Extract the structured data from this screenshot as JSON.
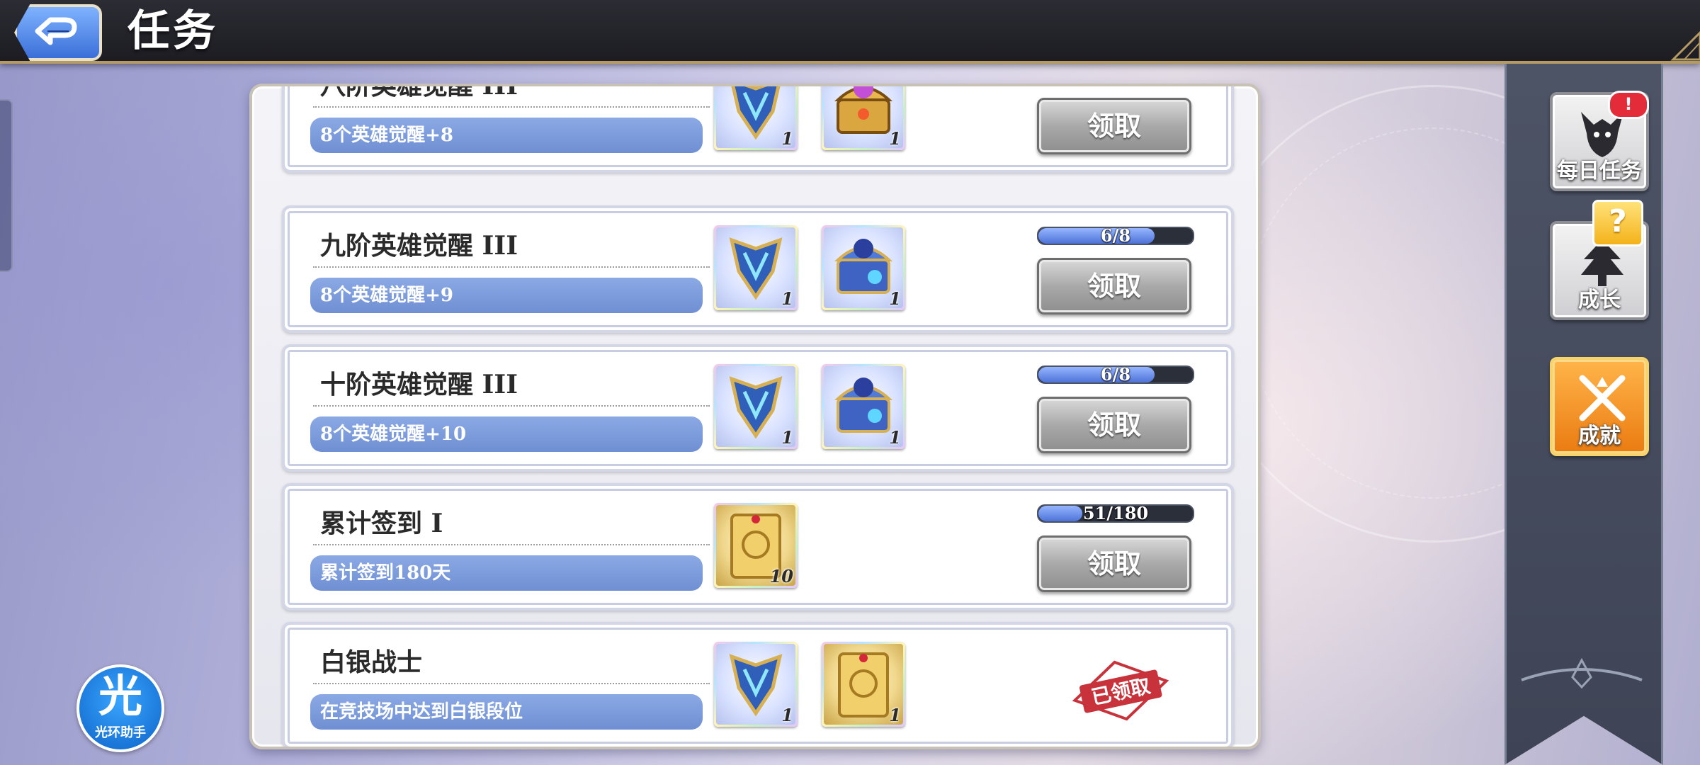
{
  "header": {
    "title": "任务",
    "back_icon": "back-arrow-icon"
  },
  "tasks": [
    {
      "name": "八阶英雄觉醒 III",
      "desc": "8个英雄觉醒+8",
      "rewards": [
        {
          "icon": "armor-piece-icon",
          "count": "1"
        },
        {
          "icon": "treasure-chest-icon",
          "count": "1"
        }
      ],
      "progress_text": "",
      "button": "领取",
      "status": "claimable"
    },
    {
      "name": "九阶英雄觉醒 III",
      "desc": "8个英雄觉醒+9",
      "rewards": [
        {
          "icon": "armor-piece-icon",
          "count": "1"
        },
        {
          "icon": "treasure-chest-icon",
          "count": "1"
        }
      ],
      "progress_text": "6/8",
      "progress_value": 0.75,
      "button": "领取",
      "status": "claimable"
    },
    {
      "name": "十阶英雄觉醒 III",
      "desc": "8个英雄觉醒+10",
      "rewards": [
        {
          "icon": "armor-piece-icon",
          "count": "1"
        },
        {
          "icon": "treasure-chest-icon",
          "count": "1"
        }
      ],
      "progress_text": "6/8",
      "progress_value": 0.75,
      "button": "领取",
      "status": "claimable"
    },
    {
      "name": "累计签到 I",
      "desc": "累计签到180天",
      "rewards": [
        {
          "icon": "gold-card-icon",
          "count": "10"
        }
      ],
      "progress_text": "51/180",
      "progress_value": 0.283,
      "button": "领取",
      "status": "claimable"
    },
    {
      "name": "白银战士",
      "desc": "在竞技场中达到白银段位",
      "rewards": [
        {
          "icon": "armor-piece-icon",
          "count": "1"
        },
        {
          "icon": "gold-card-icon",
          "count": "1"
        }
      ],
      "status": "claimed",
      "stamp": "已领取"
    }
  ],
  "sidebar": {
    "daily": {
      "label": "每日任务",
      "badge": "!",
      "icon": "demon-head-icon"
    },
    "growth": {
      "label": "成长",
      "badge": "?",
      "icon": "tree-icon"
    },
    "achievement": {
      "label": "成就",
      "icon": "crossed-swords-icon"
    }
  },
  "assistant": {
    "char": "光",
    "label": "光环助手"
  },
  "colors": {
    "accent_blue": "#7b9ddc",
    "achievement_orange": "#f0901f",
    "claimed_red": "#c8323a"
  }
}
